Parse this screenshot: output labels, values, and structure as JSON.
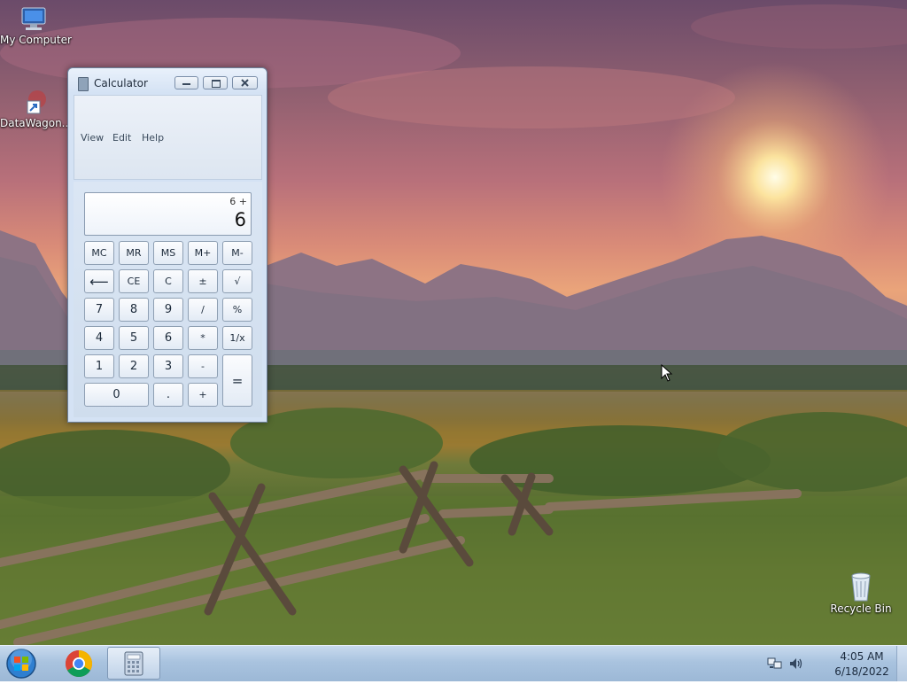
{
  "desktop": {
    "icons": [
      {
        "label": "My Computer"
      },
      {
        "label": "DataWagon..."
      },
      {
        "label": "Recycle Bin"
      }
    ]
  },
  "calculator": {
    "title": "Calculator",
    "menu": [
      "View",
      "Edit",
      "Help"
    ],
    "display": {
      "expression": "6 +",
      "value": "6"
    },
    "keys": {
      "mc": "MC",
      "mr": "MR",
      "ms": "MS",
      "mplus": "M+",
      "mminus": "M-",
      "back": "⟵",
      "ce": "CE",
      "c": "C",
      "plusminus": "±",
      "sqrt": "√",
      "k7": "7",
      "k8": "8",
      "k9": "9",
      "div": "/",
      "pct": "%",
      "k4": "4",
      "k5": "5",
      "k6": "6",
      "mul": "*",
      "recip": "1/x",
      "k1": "1",
      "k2": "2",
      "k3": "3",
      "sub": "-",
      "eq": "=",
      "k0": "0",
      "dot": ".",
      "add": "+"
    }
  },
  "taskbar": {
    "time": "4:05 AM",
    "date": "6/18/2022"
  },
  "colors": {
    "taskbar": "#a9c3df",
    "window_frame": "#d4e2f4",
    "start_orb": "#2f7fd0"
  }
}
